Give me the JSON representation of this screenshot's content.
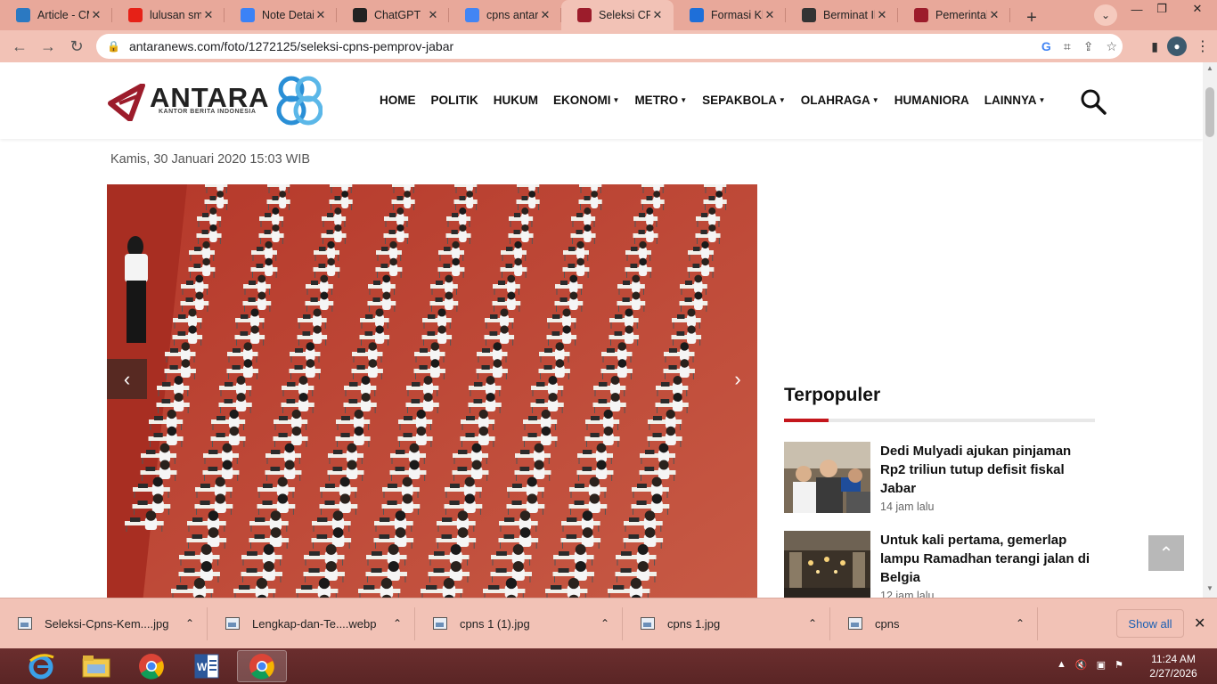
{
  "browser": {
    "tabs": [
      {
        "title": "Article - CM",
        "favicon": "cms-icon",
        "color": "#2b79c2",
        "active": false
      },
      {
        "title": "lulusan smk",
        "favicon": "youtube-icon",
        "color": "#e62117",
        "active": false
      },
      {
        "title": "Note Detail",
        "favicon": "note-icon",
        "color": "#3b82f6",
        "active": false
      },
      {
        "title": "ChatGPT",
        "favicon": "chatgpt-icon",
        "color": "#222222",
        "active": false
      },
      {
        "title": "cpns antara",
        "favicon": "google-icon",
        "color": "#4285f4",
        "active": false
      },
      {
        "title": "Seleksi CPN",
        "favicon": "antara-icon",
        "color": "#9c1c2b",
        "active": true
      },
      {
        "title": "Formasi Khu",
        "favicon": "jp-icon",
        "color": "#1e6fd9",
        "active": false
      },
      {
        "title": "Berminat Ik",
        "favicon": "mail-icon",
        "color": "#333333",
        "active": false
      },
      {
        "title": "Pemerintah",
        "favicon": "antara-icon",
        "color": "#9c1c2b",
        "active": false
      }
    ],
    "new_tab_label": "+",
    "url": "antaranews.com/foto/1272125/seleksi-cpns-pemprov-jabar"
  },
  "site": {
    "logo_text": "ANTARA",
    "logo_tagline": "KANTOR BERITA INDONESIA",
    "nav": [
      {
        "label": "HOME",
        "dropdown": false
      },
      {
        "label": "POLITIK",
        "dropdown": false
      },
      {
        "label": "HUKUM",
        "dropdown": false
      },
      {
        "label": "EKONOMI",
        "dropdown": true
      },
      {
        "label": "METRO",
        "dropdown": true
      },
      {
        "label": "SEPAKBOLA",
        "dropdown": true
      },
      {
        "label": "OLAHRAGA",
        "dropdown": true
      },
      {
        "label": "HUMANIORA",
        "dropdown": false
      },
      {
        "label": "LAINNYA",
        "dropdown": true
      }
    ],
    "brand_color": "#9c1c2b"
  },
  "article": {
    "date": "Kamis, 30 Januari 2020 15:03 WIB"
  },
  "sidebar": {
    "title": "Terpopuler",
    "items": [
      {
        "headline": "Dedi Mulyadi ajukan pinjaman Rp2 triliun tutup defisit fiskal Jabar",
        "time": "14 jam lalu"
      },
      {
        "headline": "Untuk kali pertama, gemerlap lampu Ramadhan terangi jalan di Belgia",
        "time": "12 jam lalu"
      }
    ]
  },
  "downloads": {
    "items": [
      {
        "name": "Seleksi-Cpns-Kem....jpg",
        "icon": "image-file-icon"
      },
      {
        "name": "Lengkap-dan-Te....webp",
        "icon": "chrome-file-icon"
      },
      {
        "name": "cpns 1 (1).jpg",
        "icon": "image-file-icon"
      },
      {
        "name": "cpns 1.jpg",
        "icon": "image-file-icon"
      },
      {
        "name": "cpns",
        "icon": "folder-file-icon"
      }
    ],
    "show_all": "Show all"
  },
  "taskbar": {
    "time": "11:24 AM",
    "date": "2/27/2026"
  }
}
